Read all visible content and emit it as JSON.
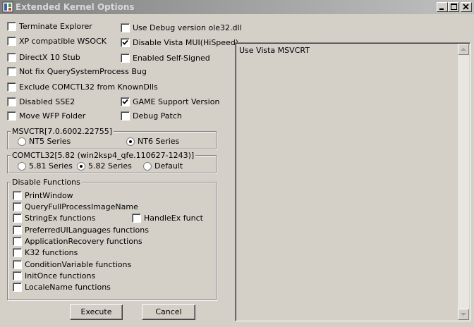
{
  "window": {
    "title": "Extended Kernel Options",
    "icon": "kernel-options-app-icon",
    "title_text_color": "#d8d8d8"
  },
  "options": {
    "left": [
      {
        "label": "Terminate Explorer",
        "checked": false
      },
      {
        "label": "XP compatible WSOCK",
        "checked": false
      },
      {
        "label": "DirectX 10 Stub",
        "checked": false
      },
      {
        "label": "Not fix QuerySystemProcess Bug",
        "checked": false
      },
      {
        "label": "Exclude COMCTL32 from KnownDlls",
        "checked": false
      },
      {
        "label": "Disabled SSE2",
        "checked": false
      },
      {
        "label": "Move WFP Folder",
        "checked": false
      }
    ],
    "right": [
      {
        "label": "Use Debug version ole32.dll",
        "checked": false
      },
      {
        "label": "Disable Vista MUI(HiSpeed)",
        "checked": true
      },
      {
        "label": "Enabled Self-Signed",
        "checked": false
      },
      {
        "label": "GAME Support Version",
        "checked": true
      },
      {
        "label": "Debug Patch",
        "checked": false
      }
    ]
  },
  "msvcrt": {
    "title": "MSVCTR[7.0.6002.22755]",
    "options": [
      "NT5 Series",
      "NT6 Series"
    ],
    "selected": "NT6 Series"
  },
  "comctl32": {
    "title": "COMCTL32[5.82 (win2ksp4_qfe.110627-1243)]",
    "options": [
      "5.81 Series",
      "5.82 Series",
      "Default"
    ],
    "selected": "5.82 Series"
  },
  "disable_functions": {
    "title": "Disable Functions",
    "items": [
      {
        "label": "PrintWindow",
        "checked": false
      },
      {
        "label": "QueryFullProcessImageName",
        "checked": false
      },
      {
        "label": "StringEx functions",
        "checked": false
      },
      {
        "label": "PreferredUILanguages functions",
        "checked": false
      },
      {
        "label": "ApplicationRecovery functions",
        "checked": false
      },
      {
        "label": "K32 functions",
        "checked": false
      },
      {
        "label": "ConditionVariable functions",
        "checked": false
      },
      {
        "label": "InitOnce functions",
        "checked": false
      },
      {
        "label": "LocaleName functions",
        "checked": false
      }
    ],
    "extra": {
      "label": "HandleEx funct",
      "checked": false
    }
  },
  "buttons": {
    "execute": "Execute",
    "cancel": "Cancel"
  },
  "listbox": {
    "items": [
      "Use Vista MSVCRT"
    ]
  }
}
